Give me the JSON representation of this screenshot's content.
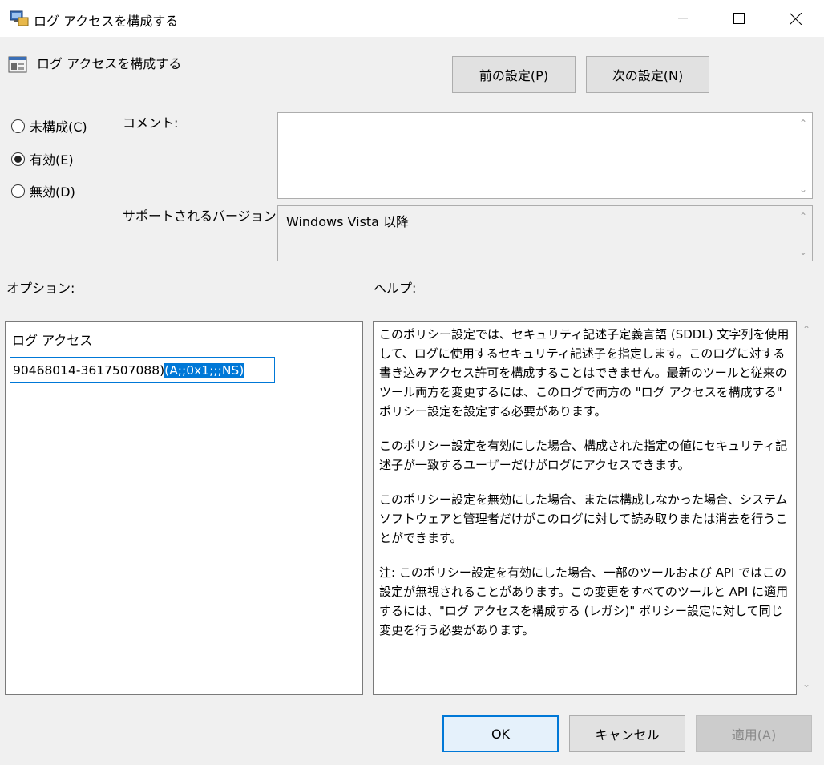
{
  "window": {
    "title": "ログ アクセスを構成する",
    "policy_name": "ログ アクセスを構成する"
  },
  "nav": {
    "prev_label": "前の設定(P)",
    "next_label": "次の設定(N)"
  },
  "state": {
    "options": [
      {
        "label": "未構成(C)",
        "selected": false
      },
      {
        "label": "有効(E)",
        "selected": true
      },
      {
        "label": "無効(D)",
        "selected": false
      }
    ]
  },
  "comment": {
    "label": "コメント:",
    "value": ""
  },
  "supported": {
    "label": "サポートされるバージョン:",
    "value": "Windows Vista 以降"
  },
  "options_section": {
    "header": "オプション:",
    "field_label": "ログ アクセス",
    "value_unselected": "90468014-3617507088)",
    "value_selected": "(A;;0x1;;;NS)"
  },
  "help_section": {
    "header": "ヘルプ:",
    "paragraphs": [
      "このポリシー設定では、セキュリティ記述子定義言語 (SDDL) 文字列を使用して、ログに使用するセキュリティ記述子を指定します。このログに対する書き込みアクセス許可を構成することはできません。最新のツールと従来のツール両方を変更するには、このログで両方の \"ログ アクセスを構成する\" ポリシー設定を設定する必要があります。",
      "このポリシー設定を有効にした場合、構成された指定の値にセキュリティ記述子が一致するユーザーだけがログにアクセスできます。",
      "このポリシー設定を無効にした場合、または構成しなかった場合、システム ソフトウェアと管理者だけがこのログに対して読み取りまたは消去を行うことができます。",
      "注: このポリシー設定を有効にした場合、一部のツールおよび API ではこの設定が無視されることがあります。この変更をすべてのツールと API に適用するには、\"ログ アクセスを構成する (レガシ)\" ポリシー設定に対して同じ変更を行う必要があります。"
    ]
  },
  "footer": {
    "ok_label": "OK",
    "cancel_label": "キャンセル",
    "apply_label": "適用(A)"
  },
  "colors": {
    "accent": "#0078d7",
    "window_bg": "#f0f0f0"
  }
}
